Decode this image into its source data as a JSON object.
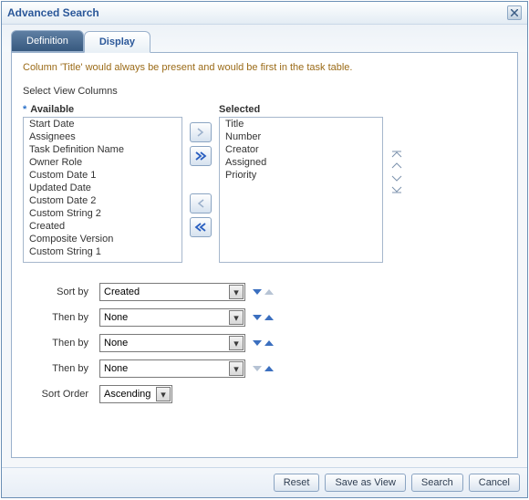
{
  "dialog": {
    "title": "Advanced Search"
  },
  "tabs": {
    "definition": "Definition",
    "display": "Display"
  },
  "helpText": "Column 'Title' would always be present and would be first in the task table.",
  "sectionLabel": "Select View Columns",
  "requiredMark": "*",
  "available": {
    "label": "Available",
    "items": [
      "Start Date",
      "Assignees",
      "Task Definition Name",
      "Owner Role",
      "Custom Date 1",
      "Updated Date",
      "Custom Date 2",
      "Custom String 2",
      "Created",
      "Composite Version",
      "Custom String 1"
    ]
  },
  "selected": {
    "label": "Selected",
    "items": [
      "Title",
      "Number",
      "Creator",
      "Assigned",
      "Priority"
    ]
  },
  "sort": {
    "labels": {
      "sortBy": "Sort by",
      "thenBy": "Then by",
      "sortOrder": "Sort Order"
    },
    "rows": [
      {
        "value": "Created"
      },
      {
        "value": "None"
      },
      {
        "value": "None"
      },
      {
        "value": "None"
      }
    ],
    "order": "Ascending"
  },
  "footer": {
    "reset": "Reset",
    "saveAsView": "Save as View",
    "search": "Search",
    "cancel": "Cancel"
  }
}
